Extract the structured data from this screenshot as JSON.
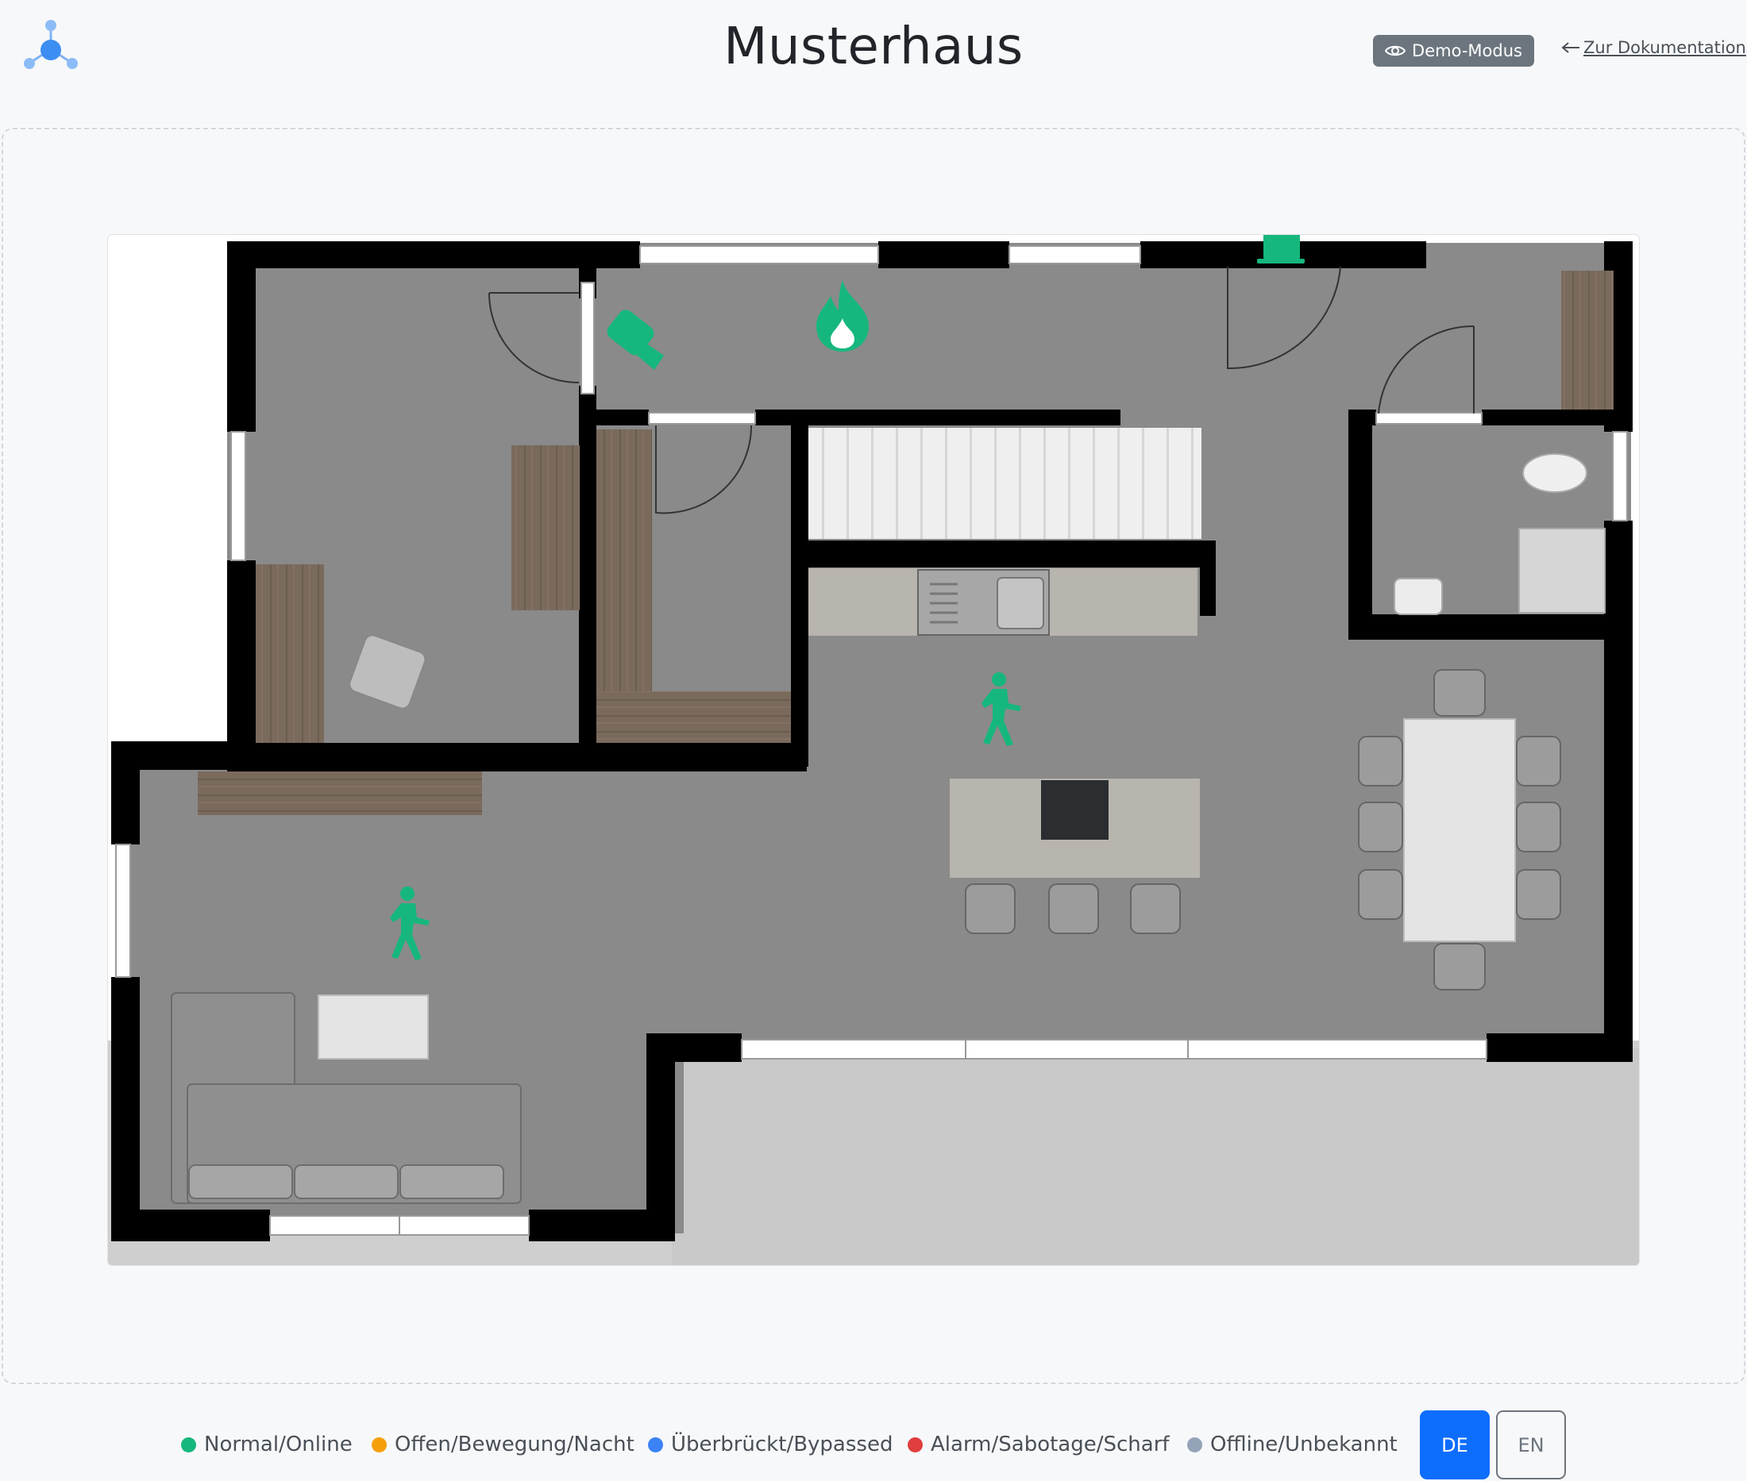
{
  "header": {
    "logo_icon": "network-nodes-icon",
    "title": "Musterhaus",
    "demo_badge": "Demo-Modus",
    "doc_link": "Zur Dokumentation"
  },
  "floorplan": {
    "sensors": [
      {
        "type": "alarm-system",
        "icon": "shield-keyhole-icon",
        "status": "normal"
      },
      {
        "type": "door-contact",
        "icon": "door-icon",
        "status": "normal"
      },
      {
        "type": "camera",
        "icon": "camera-icon",
        "status": "normal"
      },
      {
        "type": "smoke-detector",
        "icon": "fire-icon",
        "status": "normal"
      },
      {
        "type": "motion-detector",
        "icon": "walking-person-icon",
        "status": "normal"
      },
      {
        "type": "motion-detector",
        "icon": "walking-person-icon",
        "status": "normal"
      }
    ]
  },
  "legend": {
    "items": [
      {
        "label": "Normal/Online",
        "color": "#16b77d"
      },
      {
        "label": "Offen/Bewegung/Nacht",
        "color": "#f59f0b"
      },
      {
        "label": "Überbrückt/Bypassed",
        "color": "#3b82f6"
      },
      {
        "label": "Alarm/Sabotage/Scharf",
        "color": "#e03e3e"
      },
      {
        "label": "Offline/Unbekannt",
        "color": "#94a3b8"
      }
    ]
  },
  "language": {
    "de": "DE",
    "en": "EN",
    "active": "DE"
  },
  "colors": {
    "status_normal": "#16b77d",
    "primary": "#0d6efd",
    "badge": "#6c757d"
  }
}
